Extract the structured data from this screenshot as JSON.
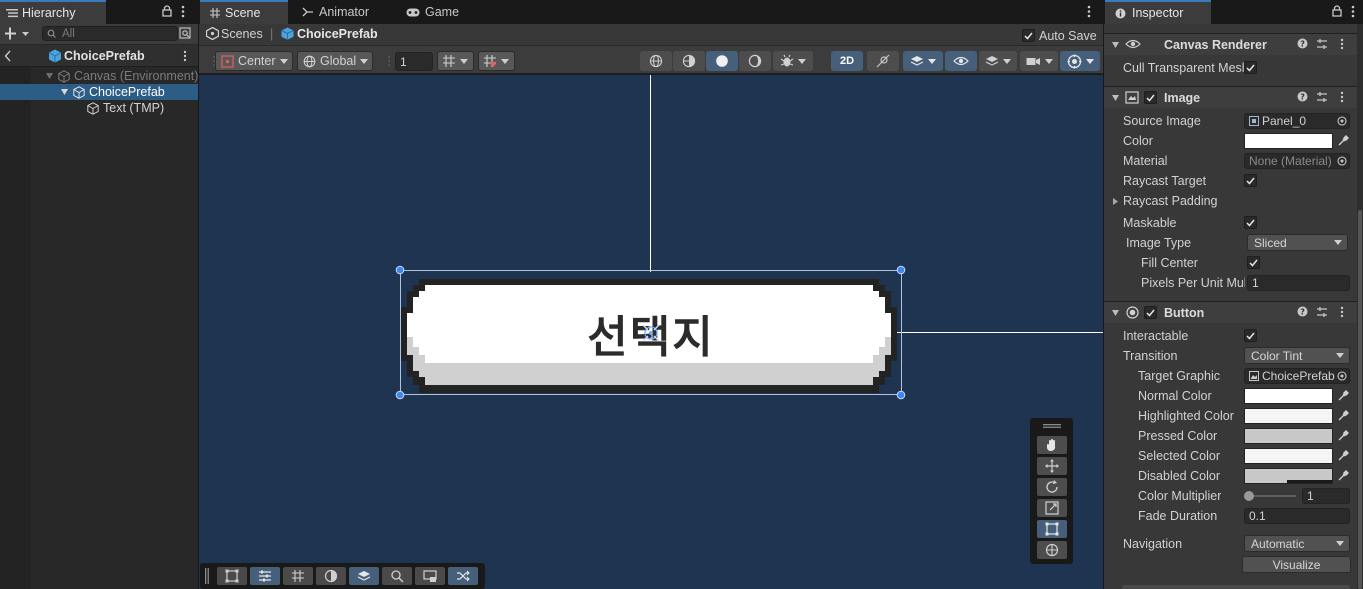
{
  "hierarchy": {
    "tab_label": "Hierarchy",
    "search_placeholder": "All",
    "root": "ChoicePrefab",
    "items": [
      {
        "label": "Canvas (Environment)",
        "depth": 1
      },
      {
        "label": "ChoicePrefab",
        "depth": 2
      },
      {
        "label": "Text (TMP)",
        "depth": 3
      }
    ]
  },
  "scene": {
    "tabs": [
      "Scene",
      "Animator",
      "Game"
    ],
    "breadcrumb": {
      "root": "Scenes",
      "current": "ChoicePrefab"
    },
    "auto_save_label": "Auto Save",
    "auto_save_checked": true,
    "toolbar": {
      "pivot": "Center",
      "space": "Global",
      "grid_size": "1",
      "mode_2d": "2D"
    },
    "button_text": "선택지"
  },
  "inspector": {
    "tab_label": "Inspector",
    "canvas_renderer": {
      "title": "Canvas Renderer",
      "cull_label": "Cull Transparent Mesh",
      "cull_checked": true
    },
    "image": {
      "title": "Image",
      "source_image_label": "Source Image",
      "source_image_value": "Panel_0",
      "color_label": "Color",
      "color_value": "#ffffff",
      "material_label": "Material",
      "material_value": "None (Material)",
      "raycast_target_label": "Raycast Target",
      "raycast_padding_label": "Raycast Padding",
      "maskable_label": "Maskable",
      "image_type_label": "Image Type",
      "image_type_value": "Sliced",
      "fill_center_label": "Fill Center",
      "ppu_label": "Pixels Per Unit Multiplier",
      "ppu_value": "1"
    },
    "button": {
      "title": "Button",
      "interactable_label": "Interactable",
      "transition_label": "Transition",
      "transition_value": "Color Tint",
      "target_graphic_label": "Target Graphic",
      "target_graphic_value": "ChoicePrefab",
      "normal_color_label": "Normal Color",
      "normal_color": "#ffffff",
      "highlighted_color_label": "Highlighted Color",
      "highlighted_color": "#f5f5f5",
      "pressed_color_label": "Pressed Color",
      "pressed_color": "#c8c8c8",
      "selected_color_label": "Selected Color",
      "selected_color": "#f5f5f5",
      "disabled_color_label": "Disabled Color",
      "disabled_color": "#c8c8c8",
      "color_multiplier_label": "Color Multiplier",
      "color_multiplier_value": "1",
      "color_multiplier_level": 0,
      "fade_duration_label": "Fade Duration",
      "fade_duration_value": "0.1",
      "navigation_label": "Navigation",
      "navigation_value": "Automatic",
      "visualize_label": "Visualize"
    }
  },
  "colors": {
    "accent": "#3a79bb",
    "selection": "#2c5d87",
    "viewport_bg": "#1e3450",
    "panel_bg": "#383838"
  }
}
